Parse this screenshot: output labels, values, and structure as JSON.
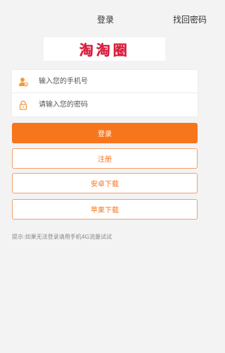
{
  "header": {
    "title": "登录",
    "forgot_password": "找回密码"
  },
  "logo": {
    "text": "淘淘圈"
  },
  "form": {
    "phone_placeholder": "输入您的手机号",
    "phone_value": "",
    "password_placeholder": "请输入您的密码",
    "password_value": "",
    "phone_icon": "user-icon",
    "password_icon": "lock-icon"
  },
  "buttons": {
    "login": "登录",
    "register": "注册",
    "android_download": "安卓下载",
    "apple_download": "苹果下载"
  },
  "tip": "提示:如果无法登录请用手机4G流量试试",
  "colors": {
    "accent": "#f7761c",
    "background": "#f3f3f3",
    "logo": "#d81e3c"
  }
}
